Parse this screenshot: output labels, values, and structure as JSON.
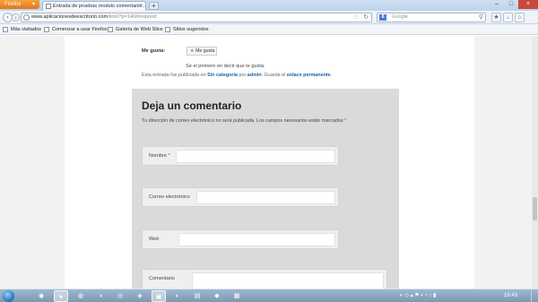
{
  "browser": {
    "menu_button": "Firefox",
    "tab_title": "Entrada de pruebas modulo comentario...",
    "url_domain": "www.aplicacionesdeescritorio.com",
    "url_path": "/test/?p=140#respond",
    "search_placeholder": "Google",
    "search_engine_badge": "8"
  },
  "bookmarks": [
    {
      "label": "Más visitados"
    },
    {
      "label": "Comenzar a usar Firefox"
    },
    {
      "label": "Galería de Web Slice"
    },
    {
      "label": "Sitios sugeridos"
    }
  ],
  "post": {
    "like_label": "Me gusta:",
    "like_button": "Me gusta",
    "like_first": "Se el primero en decir que te gusta.",
    "meta_prefix": "Esta entrada fue publicada en ",
    "meta_category": "Sin categoría",
    "meta_by": " por ",
    "meta_author": "admin",
    "meta_save": ". Guarda el ",
    "meta_permalink": "enlace permanente",
    "meta_end": "."
  },
  "comment_form": {
    "title": "Deja un comentario",
    "note": "Tu dirección de correo electrónico no será publicada. Los campos necesarios están marcados",
    "required_mark": "*",
    "fields": {
      "nombre": "Nombre",
      "correo": "Correo electrónico",
      "web": "Web",
      "comentario": "Comentario"
    }
  },
  "taskbar": {
    "clock": "16:43"
  }
}
